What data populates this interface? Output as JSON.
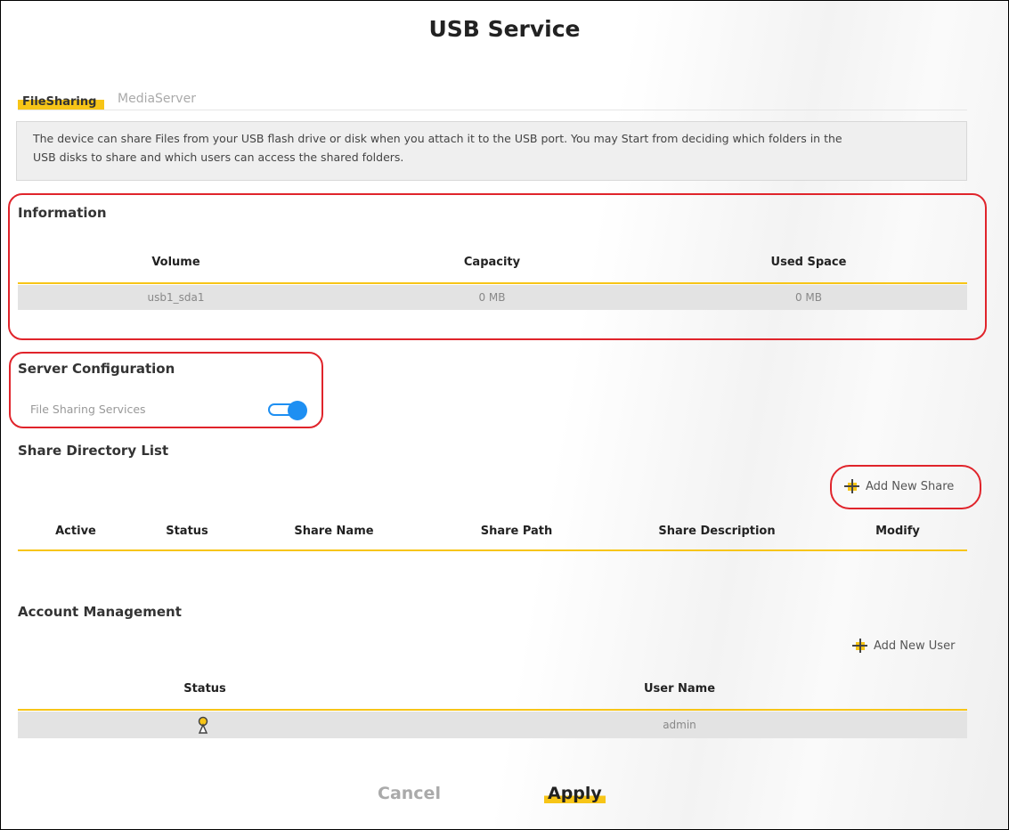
{
  "page": {
    "title": "USB Service"
  },
  "tabs": [
    {
      "label": "FileSharing",
      "active": true
    },
    {
      "label": "MediaServer",
      "active": false
    }
  ],
  "description": {
    "line1": "The device can share Files from your USB flash drive or disk when you attach it to the USB port. You may Start from deciding which folders in the",
    "line2": "USB disks to share and which users can access the shared folders."
  },
  "information": {
    "title": "Information",
    "columns": [
      "Volume",
      "Capacity",
      "Used Space"
    ],
    "rows": [
      [
        "usb1_sda1",
        "0 MB",
        "0 MB"
      ]
    ]
  },
  "server_config": {
    "title": "Server Configuration",
    "file_sharing_label": "File Sharing Services",
    "file_sharing_enabled": true
  },
  "share_directory": {
    "title": "Share Directory List",
    "add_label": "Add New Share",
    "columns": [
      "Active",
      "Status",
      "Share Name",
      "Share Path",
      "Share Description",
      "Modify"
    ]
  },
  "account_management": {
    "title": "Account Management",
    "add_label": "Add New User",
    "columns": [
      "Status",
      "User Name"
    ],
    "rows": [
      {
        "status_icon": "user-status-icon",
        "user_name": "admin"
      }
    ]
  },
  "buttons": {
    "cancel": "Cancel",
    "apply": "Apply"
  },
  "colors": {
    "accent": "#f7c517",
    "highlight_box": "#e0242b",
    "toggle": "#1e8ff2"
  }
}
